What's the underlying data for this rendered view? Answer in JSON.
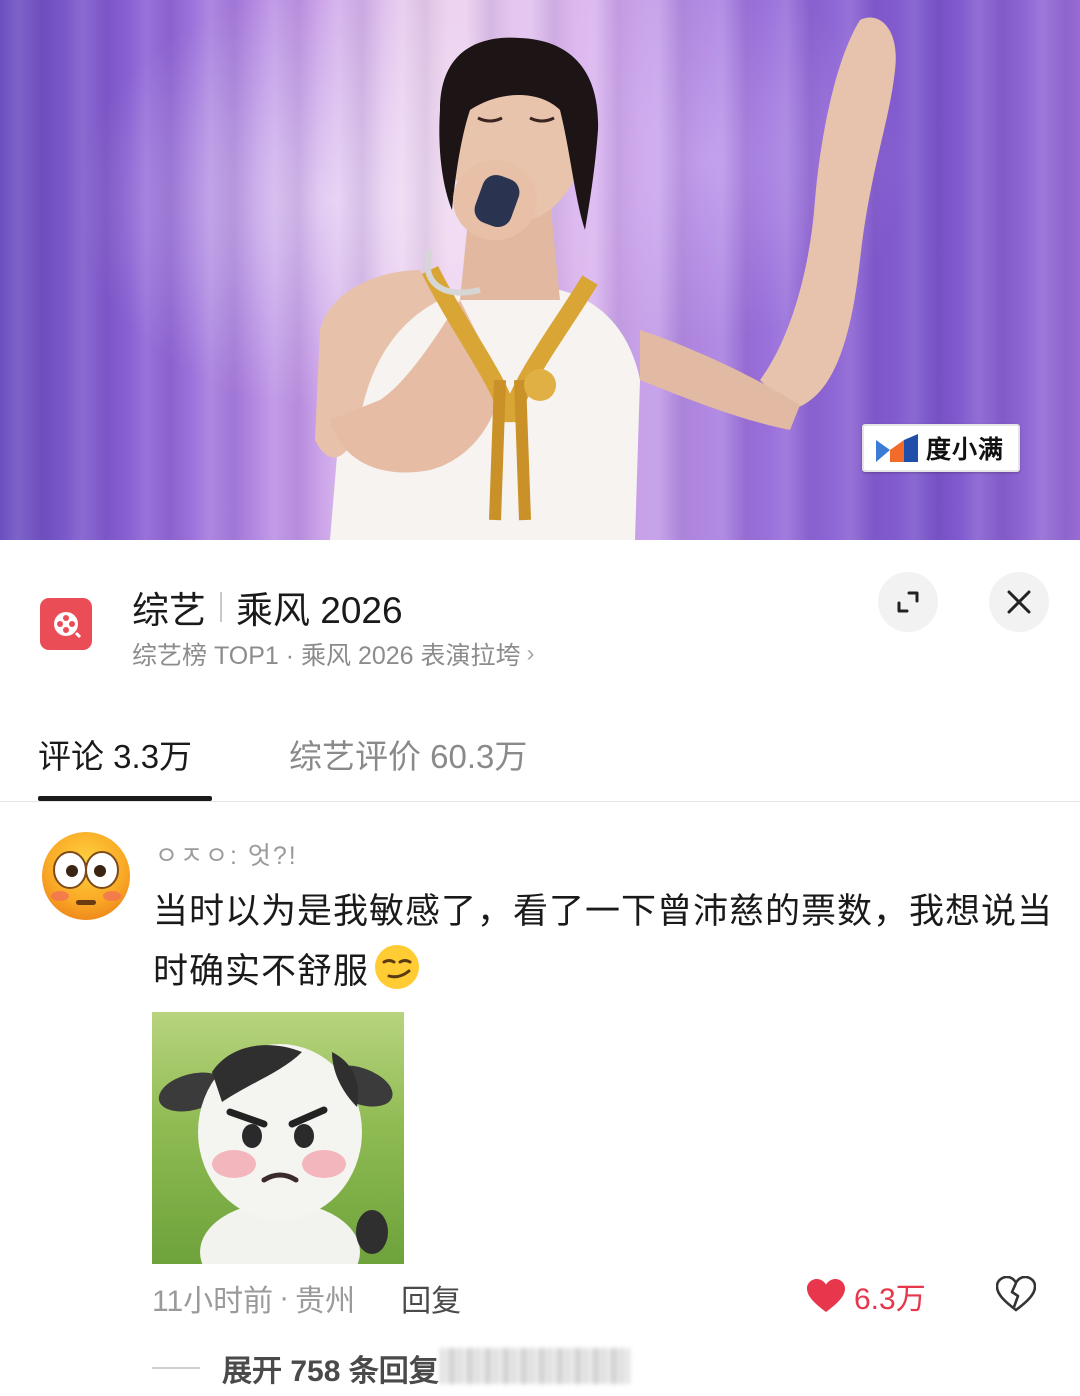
{
  "video": {
    "watermark_text": "度小满"
  },
  "header": {
    "category": "综艺",
    "title": "乘风 2026",
    "subtitle": "综艺榜 TOP1 · 乘风 2026 表演拉垮",
    "subtitle_chevron": "›",
    "app_icon": "film-reel-icon",
    "accent_color": "#ea4d55"
  },
  "tabs": [
    {
      "label": "评论 3.3万",
      "active": true
    },
    {
      "label": "综艺评价 60.3万",
      "active": false
    }
  ],
  "comment": {
    "username": "ㅇㅈㅇ: 엇?!",
    "text": "当时以为是我敏感了，看了一下曾沛慈的票数，我想说当时确实不舒服",
    "text_emoji": "smirk-emoji",
    "time": "11小时前",
    "location_separator": "·",
    "location": "贵州",
    "reply_label": "回复",
    "like_count": "6.3万",
    "like_color": "#e8364c",
    "expand_replies": "展开 758 条回复"
  }
}
